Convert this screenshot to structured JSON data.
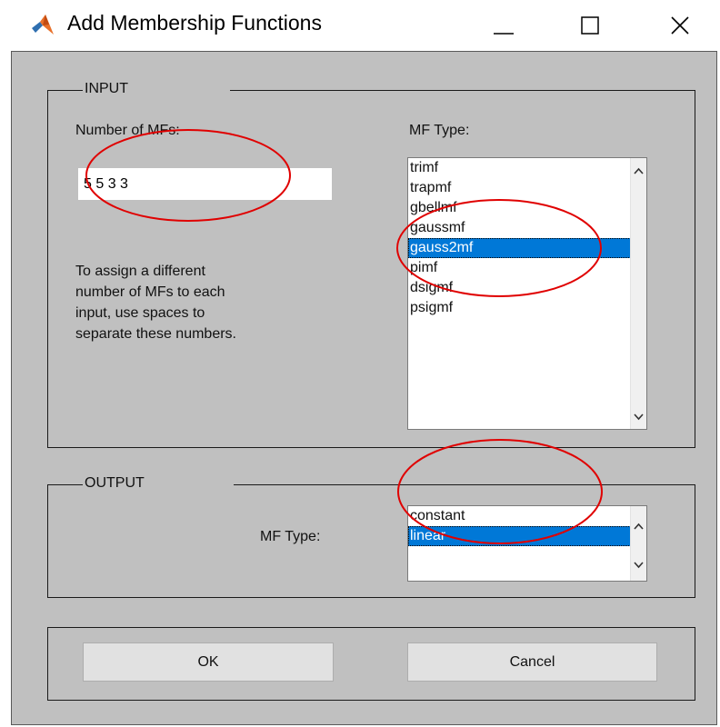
{
  "window": {
    "title": "Add Membership Functions",
    "icon": "matlab-icon",
    "controls": [
      "minimize-icon",
      "maximize-icon",
      "close-icon"
    ]
  },
  "input": {
    "legend": "INPUT",
    "num_mfs_label": "Number of MFs:",
    "num_mfs_value": "5 5 3 3",
    "help_lines": [
      "To assign a different",
      "number of MFs to each",
      "input, use spaces to",
      "separate these numbers."
    ],
    "mf_type_label": "MF Type:",
    "mf_types": [
      "trimf",
      "trapmf",
      "gbellmf",
      "gaussmf",
      "gauss2mf",
      "pimf",
      "dsigmf",
      "psigmf"
    ],
    "selected_mf_type": "gauss2mf"
  },
  "output": {
    "legend": "OUTPUT",
    "mf_type_label": "MF Type:",
    "mf_types": [
      "constant",
      "linear"
    ],
    "selected_mf_type": "linear"
  },
  "buttons": {
    "ok": "OK",
    "cancel": "Cancel"
  },
  "colors": {
    "dialog_background": "#c0c0c0",
    "selection": "#0078d7",
    "annotation": "#e00000"
  }
}
